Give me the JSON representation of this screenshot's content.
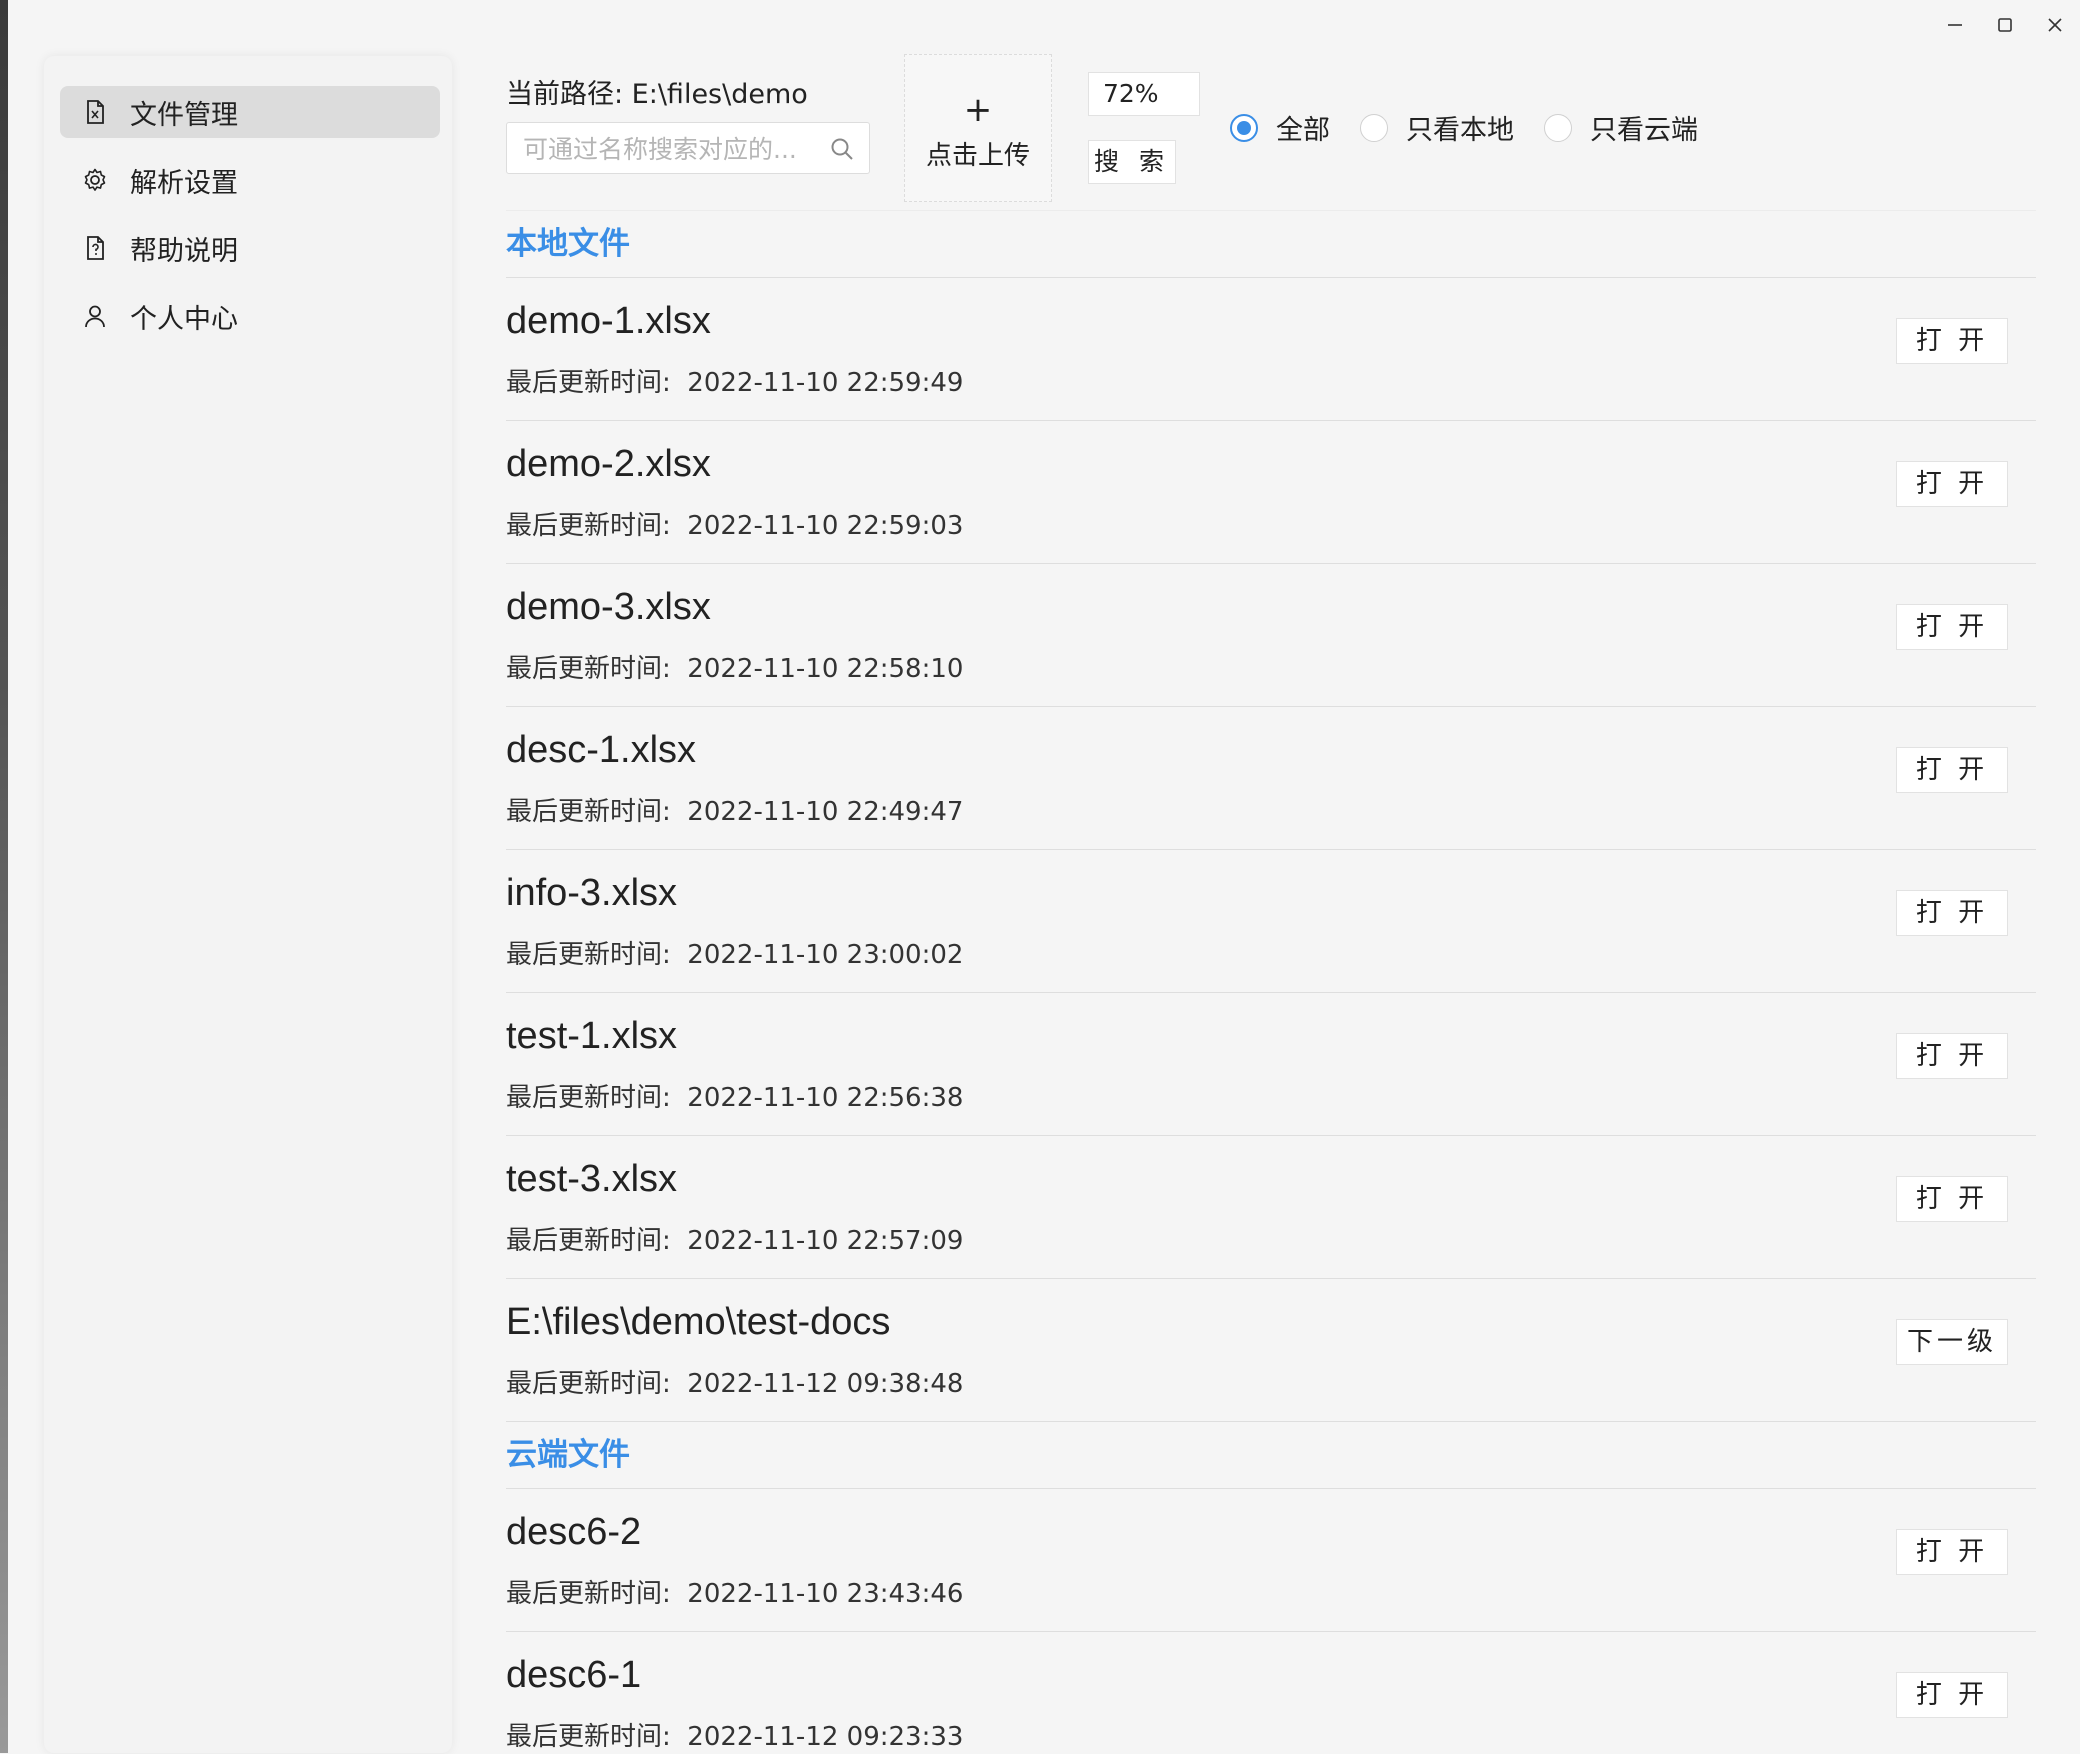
{
  "window": {
    "minimize": "—",
    "maximize": "☐",
    "close": "✕"
  },
  "sidebar": {
    "items": [
      {
        "label": "文件管理",
        "icon": "excel-file-icon",
        "active": true
      },
      {
        "label": "解析设置",
        "icon": "gear-icon",
        "active": false
      },
      {
        "label": "帮助说明",
        "icon": "help-file-icon",
        "active": false
      },
      {
        "label": "个人中心",
        "icon": "user-icon",
        "active": false
      }
    ]
  },
  "toolbar": {
    "path_label": "当前路径: E:\\files\\demo",
    "search_placeholder": "可通过名称搜索对应的...",
    "search_value": "",
    "upload_plus": "+",
    "upload_label": "点击上传",
    "zoom_value": "72%",
    "search_button": "搜 索",
    "filter": {
      "options": [
        "全部",
        "只看本地",
        "只看云端"
      ],
      "selected": "全部"
    }
  },
  "sections": {
    "local": {
      "title": "本地文件",
      "files": [
        {
          "name": "demo-1.xlsx",
          "time_label": "最后更新时间:",
          "time": "2022-11-10 22:59:49",
          "action": "打 开"
        },
        {
          "name": "demo-2.xlsx",
          "time_label": "最后更新时间:",
          "time": "2022-11-10 22:59:03",
          "action": "打 开"
        },
        {
          "name": "demo-3.xlsx",
          "time_label": "最后更新时间:",
          "time": "2022-11-10 22:58:10",
          "action": "打 开"
        },
        {
          "name": "desc-1.xlsx",
          "time_label": "最后更新时间:",
          "time": "2022-11-10 22:49:47",
          "action": "打 开"
        },
        {
          "name": "info-3.xlsx",
          "time_label": "最后更新时间:",
          "time": "2022-11-10 23:00:02",
          "action": "打 开"
        },
        {
          "name": "test-1.xlsx",
          "time_label": "最后更新时间:",
          "time": "2022-11-10 22:56:38",
          "action": "打 开"
        },
        {
          "name": "test-3.xlsx",
          "time_label": "最后更新时间:",
          "time": "2022-11-10 22:57:09",
          "action": "打 开"
        },
        {
          "name": "E:\\files\\demo\\test-docs",
          "time_label": "最后更新时间:",
          "time": "2022-11-12 09:38:48",
          "action": "下一级"
        }
      ]
    },
    "cloud": {
      "title": "云端文件",
      "files": [
        {
          "name": "desc6-2",
          "time_label": "最后更新时间:",
          "time": "2022-11-10 23:43:46",
          "action": "打 开"
        },
        {
          "name": "desc6-1",
          "time_label": "最后更新时间:",
          "time": "2022-11-12 09:23:33",
          "action": "打 开"
        }
      ]
    }
  }
}
